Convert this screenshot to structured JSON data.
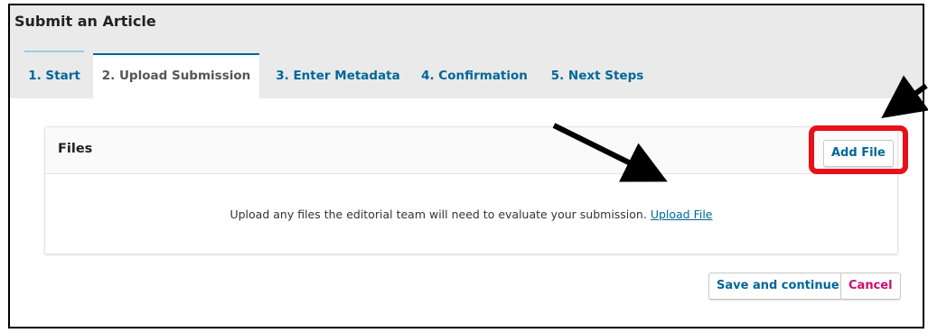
{
  "page": {
    "title": "Submit an Article"
  },
  "tabs": [
    {
      "label": "1. Start"
    },
    {
      "label": "2. Upload Submission"
    },
    {
      "label": "3. Enter Metadata"
    },
    {
      "label": "4. Confirmation"
    },
    {
      "label": "5. Next Steps"
    }
  ],
  "files": {
    "title": "Files",
    "add_button": "Add File",
    "empty_message": "Upload any files the editorial team will need to evaluate your submission.",
    "upload_link": "Upload File"
  },
  "actions": {
    "save_label": "Save and continue",
    "cancel_label": "Cancel"
  },
  "colors": {
    "link": "#006798",
    "cancel": "#d00a6c",
    "highlight": "#e8111a",
    "annotation_arrow": "#000000"
  }
}
